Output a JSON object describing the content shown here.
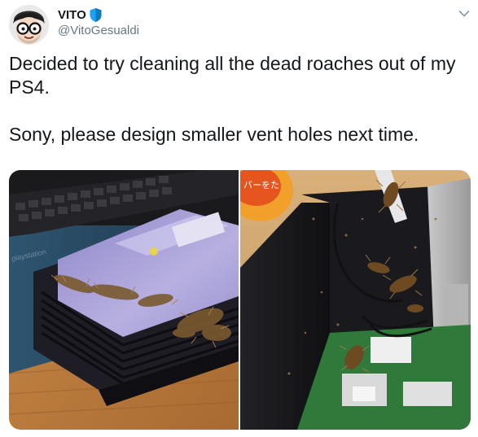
{
  "tweet": {
    "author": {
      "display_name": "VITO",
      "handle": "@VitoGesualdi",
      "verified": true,
      "verified_color": "#1da1f2",
      "avatar_icon": "cartoon-face-with-glasses-avatar"
    },
    "menu_icon": "chevron-down-icon",
    "text": {
      "line1": "Decided to try cleaning all the dead roaches out of my PS4.",
      "line2": "Sony, please design smaller vent holes next time."
    },
    "media": {
      "count": 2,
      "photo_left_text": "playstation",
      "photo_right_text": "バーをた"
    }
  },
  "colors": {
    "name": "#14171a",
    "handle": "#657786",
    "body_text": "#14171a",
    "background": "#ffffff"
  }
}
